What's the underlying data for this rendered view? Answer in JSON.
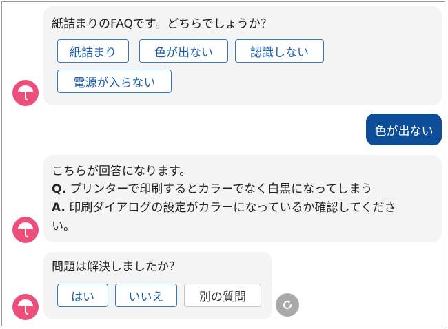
{
  "chat": {
    "bot_message_1": {
      "text": "紙詰まりのFAQです。どちらでしょうか？",
      "options": [
        "紙詰まり",
        "色が出ない",
        "認識しない",
        "電源が入らない"
      ]
    },
    "user_message": "色が出ない",
    "bot_message_2": {
      "intro": "こちらが回答になります。",
      "q_label": "Q.",
      "q_text": "プリンターで印刷するとカラーでなく白黒になってしまう",
      "a_label": "A.",
      "a_text_line1": "印刷ダイアログの設定がカラーになっているか確認してくださ",
      "a_text_line2": "い。"
    },
    "bot_message_3": {
      "text": "問題は解決しましたか？",
      "options": [
        "はい",
        "いいえ",
        "別の質問"
      ]
    }
  },
  "colors": {
    "bot_avatar": "#ec4f79",
    "user_bubble": "#0d4c96",
    "chip_border": "#2f79c9"
  },
  "icons": {
    "avatar": "umbrella-icon",
    "refresh": "refresh-icon"
  }
}
